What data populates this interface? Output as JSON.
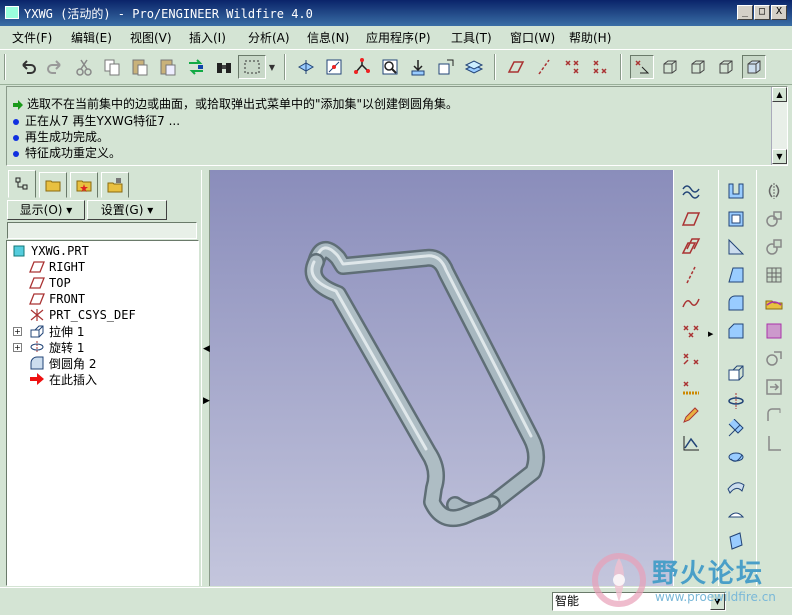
{
  "window": {
    "title": "YXWG (活动的) - Pro/ENGINEER Wildfire 4.0",
    "minimize": "_",
    "maximize": "□",
    "close": "X"
  },
  "menu": [
    "文件(F)",
    "编辑(E)",
    "视图(V)",
    "插入(I)",
    "分析(A)",
    "信息(N)",
    "应用程序(P)",
    "工具(T)",
    "窗口(W)",
    "帮助(H)"
  ],
  "messages": [
    {
      "type": "prompt",
      "text": "选取不在当前集中的边或曲面，或拾取弹出式菜单中的\"添加集\"以创建倒圆角集。"
    },
    {
      "type": "info",
      "text": "正在从7 再生YXWG特征7 ..."
    },
    {
      "type": "info",
      "text": "再生成功完成。"
    },
    {
      "type": "info",
      "text": "特征成功重定义。"
    }
  ],
  "panel": {
    "show_button": "显示(O) ▾",
    "settings_button": "设置(G) ▾"
  },
  "tree": [
    {
      "label": "YXWG.PRT",
      "icon": "part-icon",
      "indent": 0
    },
    {
      "label": "RIGHT",
      "icon": "datum-plane-icon",
      "indent": 1
    },
    {
      "label": "TOP",
      "icon": "datum-plane-icon",
      "indent": 1
    },
    {
      "label": "FRONT",
      "icon": "datum-plane-icon",
      "indent": 1
    },
    {
      "label": "PRT_CSYS_DEF",
      "icon": "csys-icon",
      "indent": 1
    },
    {
      "label": "拉伸 1",
      "icon": "extrude-icon",
      "indent": 1,
      "expandable": true
    },
    {
      "label": "旋转 1",
      "icon": "revolve-icon",
      "indent": 1,
      "expandable": true
    },
    {
      "label": "倒圆角 2",
      "icon": "round-icon",
      "indent": 1
    },
    {
      "label": "在此插入",
      "icon": "insert-here-icon",
      "indent": 1
    }
  ],
  "status": {
    "filter": "智能"
  },
  "watermark": {
    "text": "野火论坛",
    "url": "www.proewildfire.cn"
  },
  "colors": {
    "ui_bg": "#d4e4d4",
    "title_bar": "#0a246a",
    "viewport_top": "#8a8dbb",
    "viewport_bottom": "#c4c6dd",
    "model": "#a8b8c0"
  }
}
